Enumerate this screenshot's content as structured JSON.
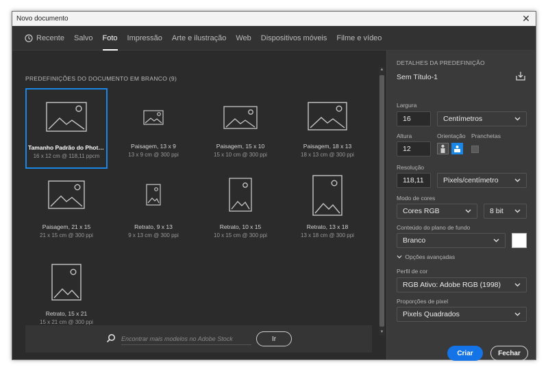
{
  "window": {
    "title": "Novo documento"
  },
  "tabs": [
    {
      "label": "Recente",
      "icon": "clock-icon"
    },
    {
      "label": "Salvo"
    },
    {
      "label": "Foto",
      "active": true
    },
    {
      "label": "Impressão"
    },
    {
      "label": "Arte e ilustração"
    },
    {
      "label": "Web"
    },
    {
      "label": "Dispositivos móveis"
    },
    {
      "label": "Filme e vídeo"
    }
  ],
  "presets_section": {
    "title": "PREDEFINIÇÕES DO DOCUMENTO EM BRANCO",
    "count": "(9)"
  },
  "presets": [
    {
      "name": "Tamanho Padrão do Photo...",
      "dims": "16 x 12 cm @ 118,11 ppcm",
      "selected": true,
      "orientation": "landscape-large"
    },
    {
      "name": "Paisagem, 13 x 9",
      "dims": "13 x 9 cm @ 300 ppi",
      "orientation": "landscape-small"
    },
    {
      "name": "Paisagem, 15 x 10",
      "dims": "15 x 10 cm @ 300 ppi",
      "orientation": "landscape-medium"
    },
    {
      "name": "Paisagem, 18 x 13",
      "dims": "18 x 13 cm @ 300 ppi",
      "orientation": "landscape-medium2"
    },
    {
      "name": "Paisagem, 21 x 15",
      "dims": "21 x 15 cm @ 300 ppi",
      "orientation": "landscape-large"
    },
    {
      "name": "Retrato, 9 x 13",
      "dims": "9 x 13 cm @ 300 ppi",
      "orientation": "portrait-small"
    },
    {
      "name": "Retrato, 10 x 15",
      "dims": "10 x 15 cm @ 300 ppi",
      "orientation": "portrait-medium"
    },
    {
      "name": "Retrato, 13 x 18",
      "dims": "13 x 18 cm @ 300 ppi",
      "orientation": "portrait-large"
    },
    {
      "name": "Retrato, 15 x 21",
      "dims": "15 x 21 cm @ 300 ppi",
      "orientation": "portrait-medium"
    }
  ],
  "stock_search": {
    "placeholder": "Encontrar mais modelos no Adobe Stock",
    "button_label": "Ir"
  },
  "details": {
    "section_title": "DETALHES DA PREDEFINIÇÃO",
    "doc_name": "Sem Título-1",
    "width_label": "Largura",
    "width_value": "16",
    "width_unit": "Centímetros",
    "height_label": "Altura",
    "height_value": "12",
    "orientation_label": "Orientação",
    "artboards_label": "Pranchetas",
    "resolution_label": "Resolução",
    "resolution_value": "118,11",
    "resolution_unit": "Pixels/centímetro",
    "color_mode_label": "Modo de cores",
    "color_mode_value": "Cores RGB",
    "bit_depth_value": "8 bit",
    "background_label": "Conteúdo do plano de fundo",
    "background_value": "Branco",
    "background_color": "#ffffff",
    "advanced_label": "Opções avançadas",
    "color_profile_label": "Perfil de cor",
    "color_profile_value": "RGB Ativo: Adobe RGB (1998)",
    "pixel_aspect_label": "Proporções de pixel",
    "pixel_aspect_value": "Pixels Quadrados"
  },
  "actions": {
    "create_label": "Criar",
    "close_label": "Fechar"
  },
  "colors": {
    "accent": "#1473e6",
    "selection": "#1a86e6",
    "panel_bg": "#3a3a3a",
    "dialog_bg": "#2b2b2b"
  }
}
